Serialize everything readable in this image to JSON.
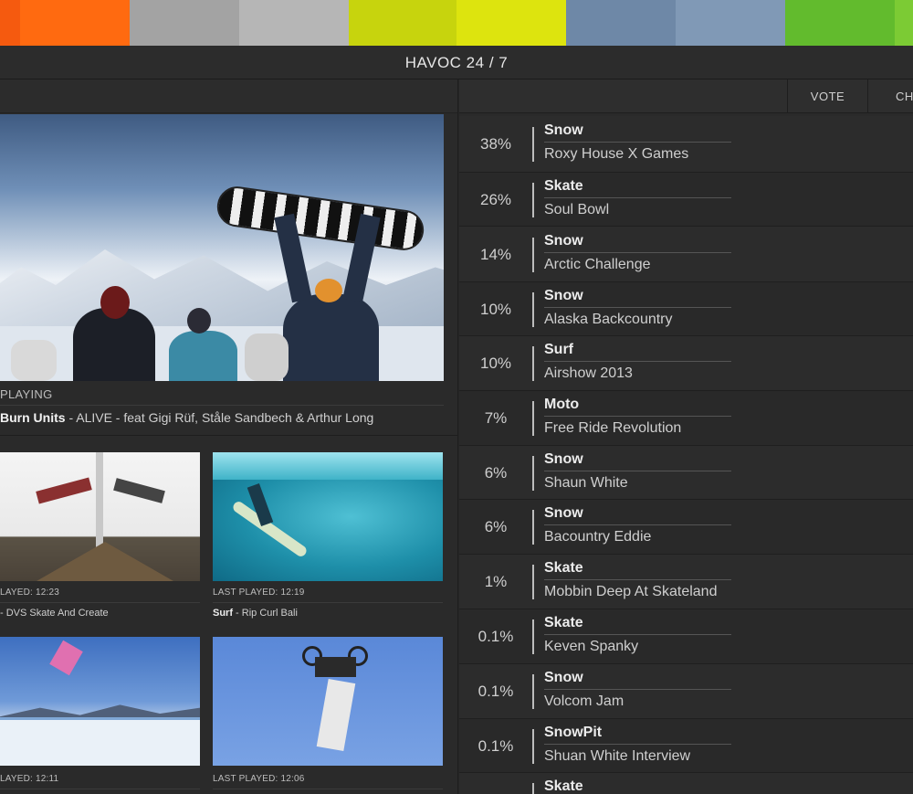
{
  "colorbar": [
    "#f55a0f",
    "#ff6a10",
    "#a3a3a3",
    "#b6b6b6",
    "#c7d40d",
    "#dde40e",
    "#6e88a7",
    "#8099b6",
    "#62bb2d",
    "#7ccb34"
  ],
  "header": {
    "title": "HAVOC 24 / 7"
  },
  "tabs": {
    "vote": "VOTE",
    "ch": "CH"
  },
  "now_playing": {
    "label": "PLAYING",
    "artist": "Burn Units",
    "rest": " - ALIVE - feat Gigi Rüf, Ståle Sandbech & Arthur Long"
  },
  "thumbs": [
    {
      "meta": "LAYED: 12:23",
      "cat": "",
      "title": "- DVS Skate And Create"
    },
    {
      "meta": "LAST PLAYED: 12:19",
      "cat": "Surf",
      "title": " - Rip Curl Bali"
    },
    {
      "meta": "LAYED: 12:11",
      "cat": "",
      "title": ""
    },
    {
      "meta": "LAST PLAYED: 12:06",
      "cat": "",
      "title": ""
    }
  ],
  "votes": [
    {
      "pct": "38%",
      "cat": "Snow",
      "name": "Roxy House X Games"
    },
    {
      "pct": "26%",
      "cat": "Skate",
      "name": "Soul Bowl"
    },
    {
      "pct": "14%",
      "cat": "Snow",
      "name": "Arctic Challenge"
    },
    {
      "pct": "10%",
      "cat": "Snow",
      "name": "Alaska Backcountry"
    },
    {
      "pct": "10%",
      "cat": "Surf",
      "name": "Airshow 2013"
    },
    {
      "pct": "7%",
      "cat": "Moto",
      "name": "Free Ride Revolution"
    },
    {
      "pct": "6%",
      "cat": "Snow",
      "name": "Shaun White"
    },
    {
      "pct": "6%",
      "cat": "Snow",
      "name": "Bacountry Eddie"
    },
    {
      "pct": "1%",
      "cat": "Skate",
      "name": "Mobbin Deep At Skateland"
    },
    {
      "pct": "0.1%",
      "cat": "Skate",
      "name": "Keven Spanky"
    },
    {
      "pct": "0.1%",
      "cat": "Snow",
      "name": "Volcom Jam"
    },
    {
      "pct": "0.1%",
      "cat": "SnowPit",
      "name": "Shuan White Interview"
    },
    {
      "pct": "",
      "cat": "Skate",
      "name": ""
    }
  ]
}
